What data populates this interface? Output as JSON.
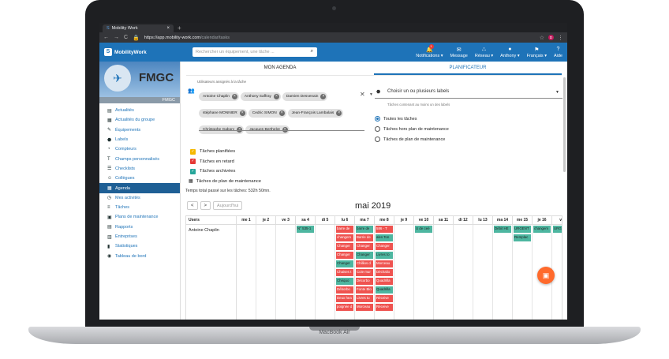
{
  "browser": {
    "tab_title": "Mobility Work",
    "tab_close": "×",
    "new_tab": "+",
    "url_host": "https://app.mobility-work.com",
    "url_path": "/calendar/tasks",
    "profile_initial": "D"
  },
  "app": {
    "logo_text": "MobilityWork",
    "search_placeholder": "Rechercher un équipement, une tâche ...",
    "nav": [
      {
        "label": "Notifications ▾",
        "icon": "bell-icon",
        "badge": "1"
      },
      {
        "label": "Message",
        "icon": "chat-icon"
      },
      {
        "label": "Réseau ▾",
        "icon": "network-icon"
      },
      {
        "label": "Anthony ▾",
        "icon": "avatar-icon"
      },
      {
        "label": "Français ▾",
        "icon": "flag-icon"
      },
      {
        "label": "Aide",
        "icon": "help-icon"
      }
    ]
  },
  "sidebar": {
    "company": "FMGC",
    "company_sub": "FMGC",
    "items": [
      {
        "label": "Actualités",
        "icon": "newspaper-icon"
      },
      {
        "label": "Actualités du groupe",
        "icon": "grid-icon"
      },
      {
        "label": "Équipements",
        "icon": "wrench-icon"
      },
      {
        "label": "Labels",
        "icon": "tag-icon"
      },
      {
        "label": "Compteurs",
        "icon": "counter-icon"
      },
      {
        "label": "Champs personnalisés",
        "icon": "text-icon"
      },
      {
        "label": "Checklists",
        "icon": "checklist-icon"
      },
      {
        "label": "Collègues",
        "icon": "people-icon"
      },
      {
        "label": "Agenda",
        "icon": "calendar-icon",
        "active": true
      },
      {
        "label": "Mes activités",
        "icon": "activity-icon"
      },
      {
        "label": "Tâches",
        "icon": "tasks-icon"
      },
      {
        "label": "Plans de maintenance",
        "icon": "plan-icon"
      },
      {
        "label": "Rapports",
        "icon": "report-icon"
      },
      {
        "label": "Entreprises",
        "icon": "building-icon"
      },
      {
        "label": "Statistiques",
        "icon": "stats-icon"
      },
      {
        "label": "Tableau de bord",
        "icon": "dashboard-icon"
      }
    ]
  },
  "main": {
    "tabs": [
      {
        "label": "MON AGENDA"
      },
      {
        "label": "PLANIFICATEUR",
        "active": true
      }
    ],
    "assignee_label": "Utilisateurs assignés à la tâche",
    "assignees": [
      "Antoine Chaplin",
      "Anthony Saffray",
      "Damien Desvenain",
      "stéphane MONNIER",
      "Cedric SIMON",
      "Jean-François Lambalais",
      "Christophe Gabory",
      "Jacques Berthelot"
    ],
    "labels_placeholder": "Choisir un ou plusieurs labels",
    "labels_hint": "Tâches contenant au moins un des labels",
    "radios": [
      {
        "label": "Toutes les tâches",
        "checked": true
      },
      {
        "label": "Tâches hors plan de maintenance",
        "checked": false
      },
      {
        "label": "Tâches de plan de maintenance",
        "checked": false
      }
    ],
    "checks": [
      {
        "label": "Tâches planifiées",
        "color": "#f5b800"
      },
      {
        "label": "Tâches en retard",
        "color": "#e53935"
      },
      {
        "label": "Tâches archivées",
        "color": "#26a69a"
      }
    ],
    "maintenance_label": "Tâches de plan de maintenance",
    "total_time": "Temps total passé sur les tâches: 532h 50mn.",
    "prev": "<",
    "next": ">",
    "today": "Aujourd'hui",
    "month": "mai 2019"
  },
  "calendar": {
    "users_header": "Users",
    "days": [
      "me 1",
      "je 2",
      "ve 3",
      "sa 4",
      "di 5",
      "lu 6",
      "ma 7",
      "me 8",
      "je 9",
      "ve 10",
      "sa 11",
      "di 12",
      "lu 13",
      "ma 14",
      "me 15",
      "je 16",
      "ve"
    ],
    "user": "Antoine Chaplin",
    "events": [
      [],
      [],
      [],
      [
        {
          "t": "N° 535-1",
          "c": "g"
        }
      ],
      [],
      [
        {
          "t": "barre de",
          "c": "r"
        },
        {
          "t": "changem",
          "c": "r"
        },
        {
          "t": "Changer",
          "c": "r"
        },
        {
          "t": "Changer",
          "c": "r"
        },
        {
          "t": "Changer",
          "c": "g"
        },
        {
          "t": "Chaises t",
          "c": "r"
        },
        {
          "t": "Chéquo",
          "c": "g"
        },
        {
          "t": "Déborbo",
          "c": "r"
        },
        {
          "t": "Deux hea",
          "c": "r"
        },
        {
          "t": "poignée d",
          "c": "r"
        }
      ],
      [
        {
          "t": "barre de",
          "c": "g"
        },
        {
          "t": "Barrie de",
          "c": "r"
        },
        {
          "t": "Changer",
          "c": "r"
        },
        {
          "t": "Changer",
          "c": "g"
        },
        {
          "t": "Chillios d",
          "c": "r"
        },
        {
          "t": "Coie mur",
          "c": "r"
        },
        {
          "t": "Décorbo",
          "c": "r"
        },
        {
          "t": "Fonte Blo",
          "c": "r"
        },
        {
          "t": "Livres tu",
          "c": "r"
        },
        {
          "t": "Morceau",
          "c": "r"
        }
      ],
      [
        {
          "t": "586 - T",
          "c": "r"
        },
        {
          "t": "ales Ton",
          "c": "g"
        },
        {
          "t": "Changer",
          "c": "r"
        },
        {
          "t": "Livres to",
          "c": "g"
        },
        {
          "t": "Morceau",
          "c": "r"
        },
        {
          "t": "Déchalio",
          "c": "r"
        },
        {
          "t": "Quadrilla",
          "c": "r"
        },
        {
          "t": "Quadrilla",
          "c": "g"
        },
        {
          "t": "Réceive",
          "c": "r"
        },
        {
          "t": "Réceive",
          "c": "r"
        }
      ],
      [],
      [
        {
          "t": "U de ceè",
          "c": "g"
        }
      ],
      [],
      [],
      [],
      [
        {
          "t": "Débit HE",
          "c": "g"
        }
      ],
      [
        {
          "t": "URGENT",
          "c": "g"
        },
        {
          "t": "Remplac",
          "c": "g"
        }
      ],
      [
        {
          "t": "changem",
          "c": "g"
        }
      ],
      [
        {
          "t": "URG",
          "c": "g"
        }
      ]
    ]
  },
  "chat_button": "▣",
  "laptop_label": "MacBook Air"
}
